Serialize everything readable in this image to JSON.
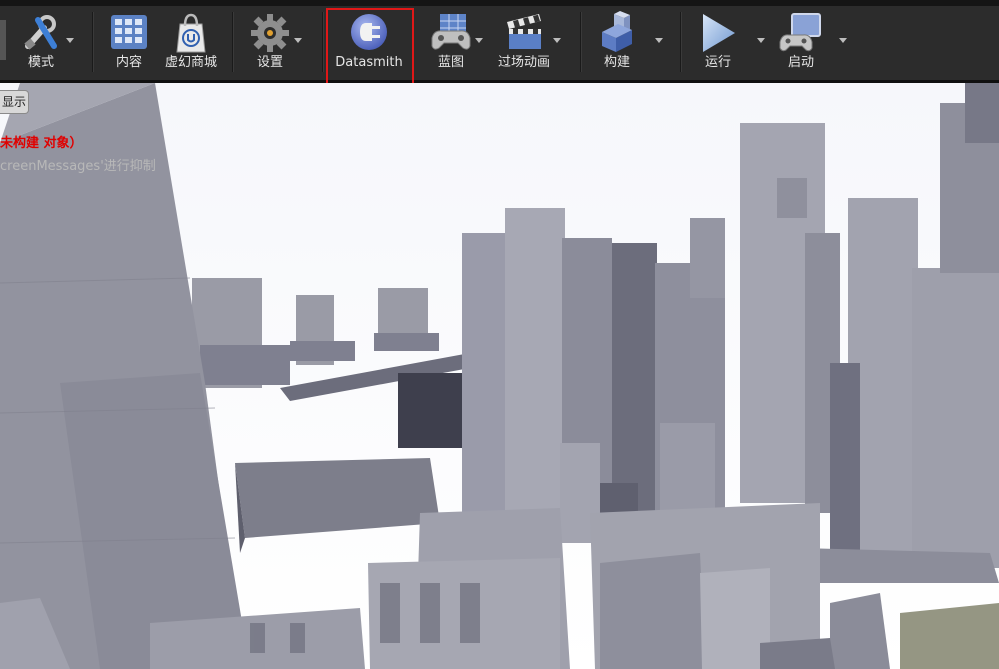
{
  "toolbar": {
    "modes": {
      "label": "模式",
      "icon": "modes-tools-icon"
    },
    "content": {
      "label": "内容",
      "icon": "content-grid-icon"
    },
    "marketplace": {
      "label": "虚幻商城",
      "icon": "marketplace-bag-icon"
    },
    "settings": {
      "label": "设置",
      "icon": "settings-gear-icon"
    },
    "datasmith": {
      "label": "Datasmith",
      "icon": "datasmith-plug-icon"
    },
    "blueprints": {
      "label": "蓝图",
      "icon": "blueprint-gamepad-icon"
    },
    "cinematics": {
      "label": "过场动画",
      "icon": "clapperboard-icon"
    },
    "build": {
      "label": "构建",
      "icon": "build-blocks-icon"
    },
    "play": {
      "label": "运行",
      "icon": "play-icon"
    },
    "launch": {
      "label": "启动",
      "icon": "launch-monitor-icon"
    }
  },
  "viewport": {
    "show_button": "显示",
    "warning_message": "未构建 对象）",
    "hint_message": "creenMessages'进行抑制"
  },
  "colors": {
    "toolbar_bg": "#2c2c2c",
    "highlight": "#e01818",
    "warning_text": "#e00000"
  }
}
